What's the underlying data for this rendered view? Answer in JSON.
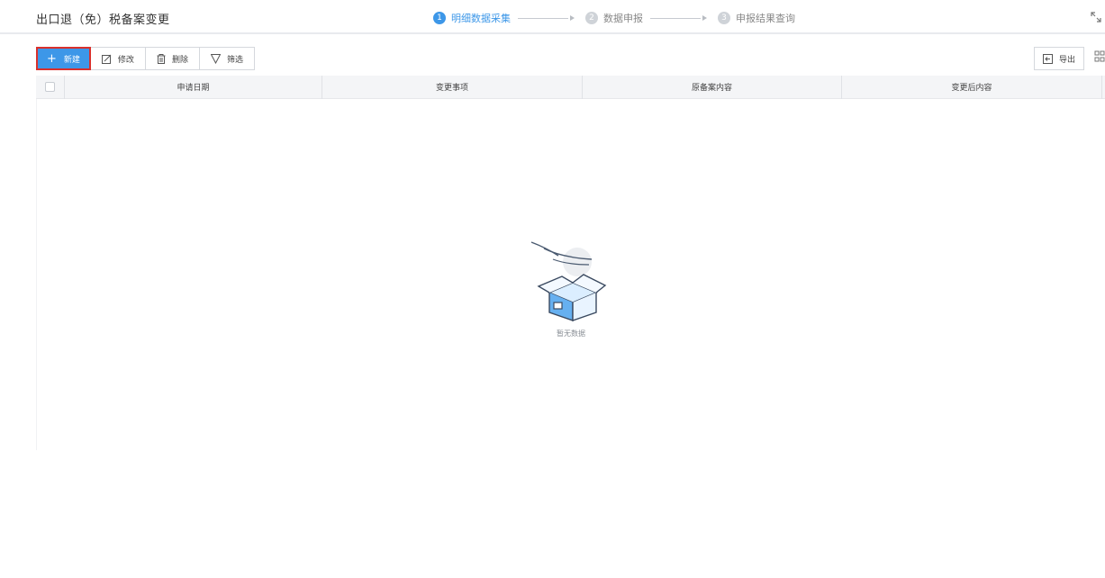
{
  "header": {
    "title": "出口退（免）税备案变更",
    "steps": [
      {
        "num": "1",
        "label": "明细数据采集",
        "active": true
      },
      {
        "num": "2",
        "label": "数据申报",
        "active": false
      },
      {
        "num": "3",
        "label": "申报结果查询",
        "active": false
      }
    ]
  },
  "toolbar": {
    "new_label": "新建",
    "edit_label": "修改",
    "delete_label": "删除",
    "filter_label": "筛选",
    "export_label": "导出"
  },
  "table": {
    "columns": [
      "申请日期",
      "变更事项",
      "原备案内容",
      "变更后内容"
    ],
    "rows": []
  },
  "empty_state": {
    "text": "暂无数据"
  },
  "colors": {
    "primary": "#3d97e8",
    "highlight_border": "#d9302c"
  }
}
